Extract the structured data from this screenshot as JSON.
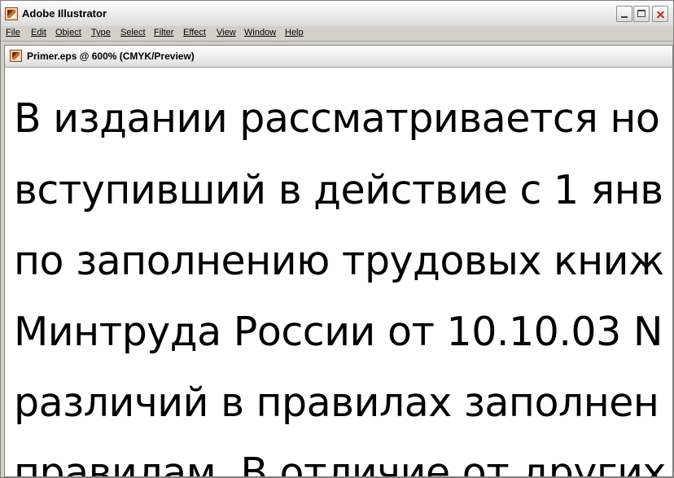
{
  "app": {
    "title": "Adobe Illustrator"
  },
  "menu": {
    "items": [
      "File",
      "Edit",
      "Object",
      "Type",
      "Select",
      "Filter",
      "Effect",
      "View",
      "Window",
      "Help"
    ]
  },
  "document": {
    "title": "Primer.eps @ 600% (CMYK/Preview)",
    "lines": [
      "В издании рассматривается но",
      "вступивший в действие с 1 янв",
      "по заполнению трудовых книж",
      "Минтруда России от 10.10.03 N",
      "различий в правилах заполнен",
      "правилам. В отличие от других"
    ]
  }
}
